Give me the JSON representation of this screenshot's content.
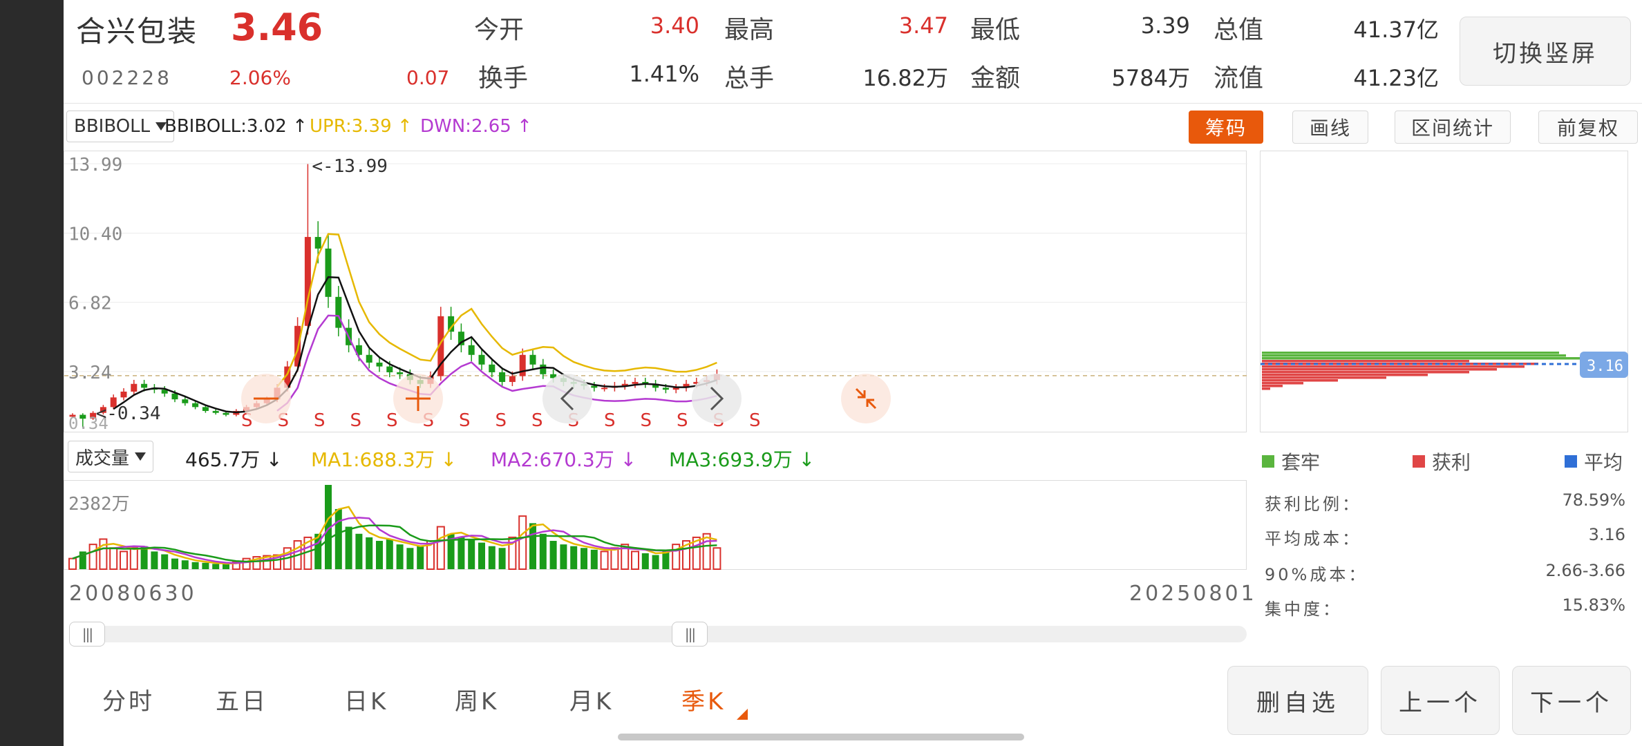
{
  "header": {
    "stock_name": "合兴包装",
    "price": "3.46",
    "code": "002228",
    "change_pct": "2.06%",
    "change_amt": "0.07",
    "quotes": [
      {
        "label": "今开",
        "value": "3.40"
      },
      {
        "label": "最高",
        "value": "3.47"
      },
      {
        "label": "最低",
        "value": "3.39"
      },
      {
        "label": "总值",
        "value": "41.37亿"
      },
      {
        "label": "换手",
        "value": "1.41%"
      },
      {
        "label": "总手",
        "value": "16.82万"
      },
      {
        "label": "金额",
        "value": "5784万"
      },
      {
        "label": "流值",
        "value": "41.23亿"
      }
    ],
    "switch_button": "切换竖屏"
  },
  "indicator": {
    "selector": "BBIBOLL",
    "bbiboll_text": "BBIBOLL:3.02 ↑",
    "upr_text": "UPR:3.39 ↑",
    "dwn_text": "DWN:2.65 ↑",
    "tools": [
      "筹码",
      "画线",
      "区间统计",
      "前复权"
    ]
  },
  "volume": {
    "selector": "成交量",
    "vol_text": "465.7万 ↓",
    "ma1_text": "MA1:688.3万 ↓",
    "ma2_text": "MA2:670.3万 ↓",
    "ma3_text": "MA3:693.9万 ↓",
    "axis_max": "2382万"
  },
  "chart_data": {
    "type": "candlestick",
    "period": "季K",
    "y_ticks": [
      "13.99",
      "10.40",
      "6.82",
      "3.24"
    ],
    "max_label": "<-13.99",
    "min_label": "<-0.34",
    "bottom_tick_partial": "0.34",
    "sell_marker": "S",
    "sell_marker_count": 15,
    "date_start": "20080630",
    "date_end": "20250801",
    "last_price_line": 3.24,
    "closes": [
      1.0,
      0.8,
      1.1,
      1.4,
      1.9,
      2.2,
      2.6,
      2.4,
      2.3,
      2.1,
      1.8,
      1.6,
      1.4,
      1.2,
      1.1,
      1.0,
      1.2,
      1.4,
      1.6,
      1.8,
      2.4,
      3.5,
      5.6,
      10.2,
      9.6,
      7.1,
      5.5,
      4.6,
      4.1,
      3.7,
      3.5,
      3.2,
      3.1,
      2.8,
      2.6,
      3.0,
      6.1,
      5.3,
      4.6,
      4.1,
      3.6,
      3.2,
      2.7,
      3.0,
      4.1,
      3.6,
      3.1,
      2.9,
      2.7,
      2.6,
      2.5,
      2.4,
      2.4,
      2.5,
      2.6,
      2.7,
      2.6,
      2.4,
      2.3,
      2.4,
      2.6,
      2.7,
      2.8,
      3.1
    ],
    "volumes": [
      300,
      500,
      700,
      850,
      600,
      500,
      600,
      650,
      500,
      420,
      300,
      250,
      200,
      180,
      150,
      140,
      200,
      300,
      350,
      380,
      400,
      600,
      800,
      900,
      1000,
      2382,
      1700,
      1200,
      1000,
      900,
      800,
      850,
      700,
      600,
      650,
      800,
      1200,
      1000,
      900,
      850,
      750,
      650,
      600,
      900,
      1500,
      1300,
      1000,
      800,
      700,
      650,
      600,
      550,
      500,
      600,
      700,
      500,
      450,
      400,
      550,
      700,
      800,
      900,
      1000,
      600
    ]
  },
  "chips": {
    "current_price_label": "3.16",
    "legend": [
      "套牢",
      "获利",
      "平均"
    ],
    "colors": {
      "trapped": "#5ab53e",
      "profit": "#e04646",
      "average": "#2f6fd6"
    },
    "stats": [
      {
        "label": "获利比例：",
        "value": "78.59%"
      },
      {
        "label": "平均成本：",
        "value": "3.16"
      },
      {
        "label": "90%成本：",
        "value": "2.66-3.66"
      },
      {
        "label": "集中度：",
        "value": "15.83%"
      }
    ]
  },
  "tabs": [
    "分时",
    "五日",
    "日K",
    "周K",
    "月K",
    "季K"
  ],
  "active_tab": "季K",
  "bottom_buttons": [
    "删自选",
    "上一个",
    "下一个"
  ],
  "colors": {
    "up": "#d9302c",
    "down": "#1a9b1a",
    "accent": "#e8590c",
    "ma_yellow": "#e6b800",
    "ma_purple": "#b43ad1",
    "ma_black": "#111111"
  }
}
